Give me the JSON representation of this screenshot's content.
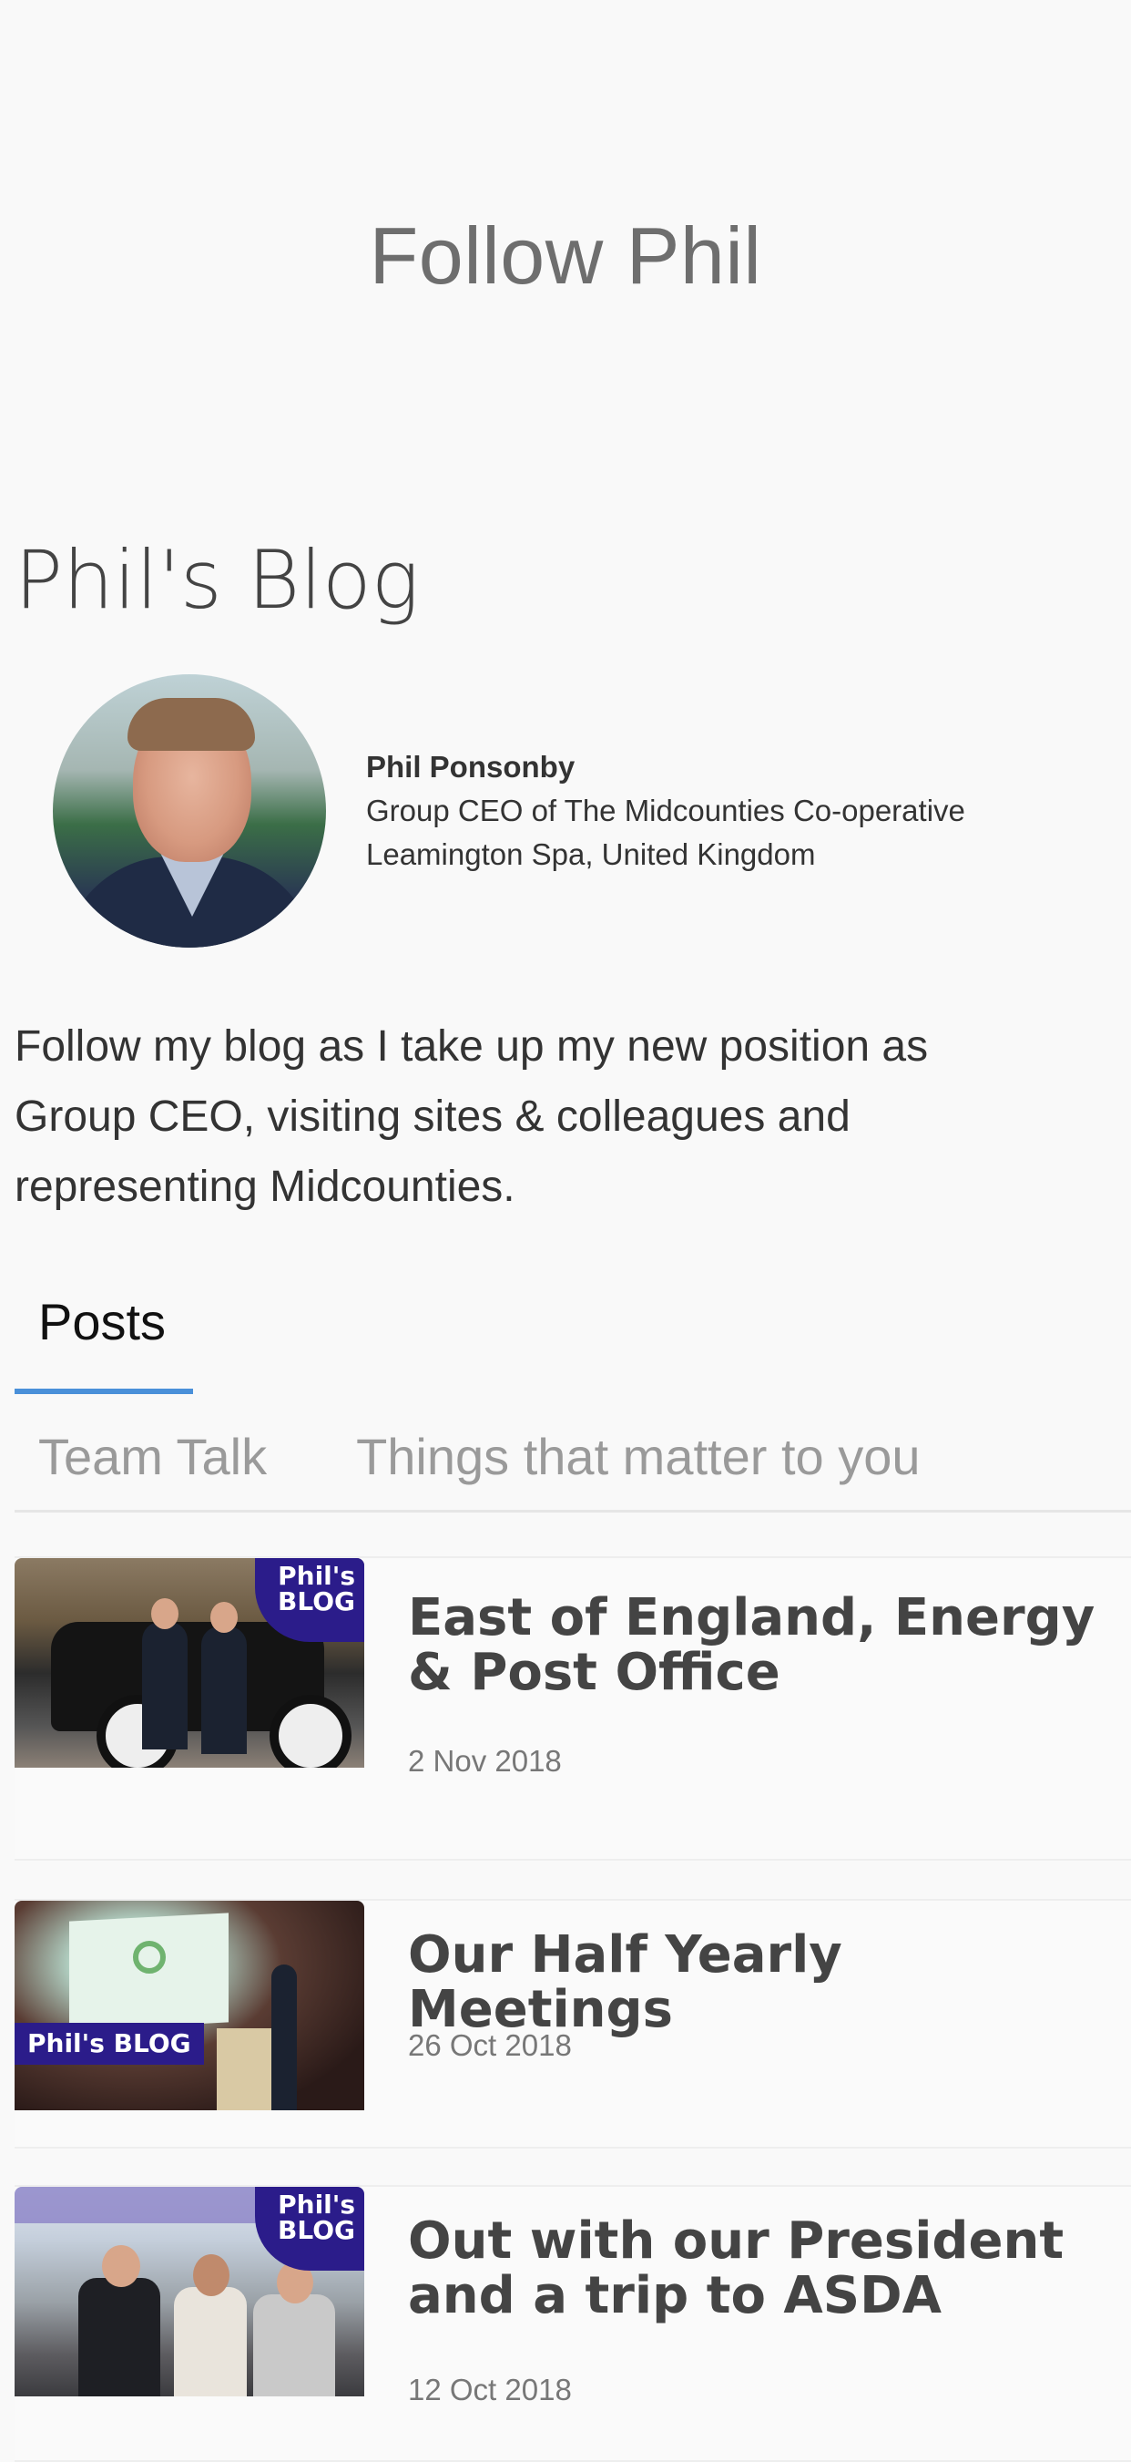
{
  "header": {
    "follow_title": "Follow Phil"
  },
  "blog": {
    "title": "Phil's Blog",
    "profile": {
      "name": "Phil Ponsonby",
      "role": "Group CEO of The Midcounties Co-operative",
      "location": "Leamington Spa, United Kingdom"
    },
    "intro": "Follow my blog as I take up my new position as Group CEO, visiting sites & colleagues and representing Midcounties."
  },
  "tabs": {
    "primary": "Posts",
    "secondary": [
      "Team Talk",
      "Things that matter to you"
    ]
  },
  "badge_label": "Phil's BLOG",
  "badge_line1": "Phil's",
  "badge_line2": "BLOG",
  "posts": [
    {
      "title": "East of England, Energy & Post Office",
      "date": "2 Nov 2018"
    },
    {
      "title": "Our Half Yearly Meetings",
      "date": "26 Oct 2018"
    },
    {
      "title": "Out with our President and a trip to ASDA",
      "date": "12 Oct 2018"
    }
  ],
  "colors": {
    "accent": "#4a90d9",
    "badge": "#2b1c8a"
  }
}
